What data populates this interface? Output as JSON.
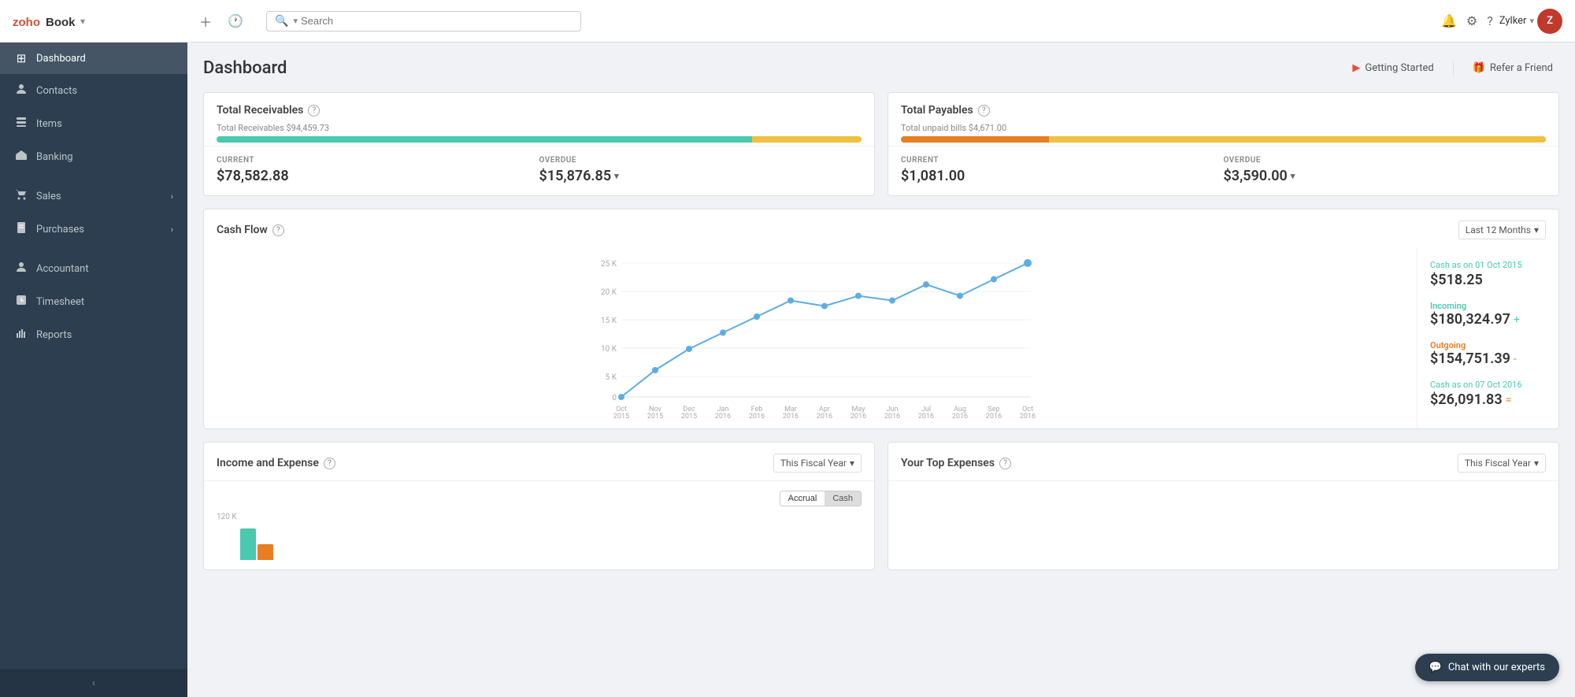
{
  "topbar": {
    "logo": "Books",
    "logo_brand": "zoho",
    "search_placeholder": "Search",
    "user_name": "Zylker",
    "user_initials": "Z"
  },
  "sidebar": {
    "items": [
      {
        "id": "dashboard",
        "label": "Dashboard",
        "icon": "⊞",
        "active": true
      },
      {
        "id": "contacts",
        "label": "Contacts",
        "icon": "👤"
      },
      {
        "id": "items",
        "label": "Items",
        "icon": "📦"
      },
      {
        "id": "banking",
        "label": "Banking",
        "icon": "🏛"
      },
      {
        "id": "sales",
        "label": "Sales",
        "icon": "🛒",
        "has_children": true
      },
      {
        "id": "purchases",
        "label": "Purchases",
        "icon": "📋",
        "has_children": true
      },
      {
        "id": "accountant",
        "label": "Accountant",
        "icon": "👤"
      },
      {
        "id": "timesheet",
        "label": "Timesheet",
        "icon": "📅"
      },
      {
        "id": "reports",
        "label": "Reports",
        "icon": "📊"
      }
    ]
  },
  "page": {
    "title": "Dashboard",
    "header_actions": [
      {
        "id": "getting-started",
        "label": "Getting Started",
        "icon": "▶"
      },
      {
        "id": "refer-friend",
        "label": "Refer a Friend",
        "icon": "🎁"
      }
    ]
  },
  "total_receivables": {
    "title": "Total Receivables",
    "bar_label": "Total Receivables $94,459.73",
    "bar_teal_pct": 83,
    "bar_yellow_pct": 17,
    "current_label": "CURRENT",
    "current_value": "$78,582.88",
    "overdue_label": "OVERDUE",
    "overdue_value": "$15,876.85"
  },
  "total_payables": {
    "title": "Total Payables",
    "bar_label": "Total unpaid bills $4,671.00",
    "bar_orange_pct": 23,
    "bar_yellow_pct": 77,
    "current_label": "CURRENT",
    "current_value": "$1,081.00",
    "overdue_label": "OVERDUE",
    "overdue_value": "$3,590.00"
  },
  "cash_flow": {
    "title": "Cash Flow",
    "filter_label": "Last 12 Months",
    "cash_as_on_start_label": "Cash as on 01 Oct 2015",
    "cash_start_value": "$518.25",
    "incoming_label": "Incoming",
    "incoming_value": "$180,324.97",
    "outgoing_label": "Outgoing",
    "outgoing_value": "$154,751.39",
    "cash_as_on_end_label": "Cash as on 07 Oct 2016",
    "cash_end_value": "$26,091.83",
    "x_labels": [
      "Oct\n2015",
      "Nov\n2015",
      "Dec\n2015",
      "Jan\n2016",
      "Feb\n2016",
      "Mar\n2016",
      "Apr\n2016",
      "May\n2016",
      "Jun\n2016",
      "Jul\n2016",
      "Aug\n2016",
      "Sep\n2016",
      "Oct\n2016"
    ],
    "y_labels": [
      "25 K",
      "20 K",
      "15 K",
      "10 K",
      "5 K",
      "0"
    ],
    "data_points": [
      0,
      5,
      9,
      12,
      15,
      18,
      17,
      19,
      18,
      21,
      19,
      23,
      25
    ]
  },
  "income_expense": {
    "title": "Income and Expense",
    "filter_label": "This Fiscal Year",
    "btn_accrual": "Accrual",
    "btn_cash": "Cash",
    "y_label_value": "120 K"
  },
  "top_expenses": {
    "title": "Your Top Expenses",
    "filter_label": "This Fiscal Year"
  },
  "chat": {
    "label": "Chat with our experts"
  }
}
